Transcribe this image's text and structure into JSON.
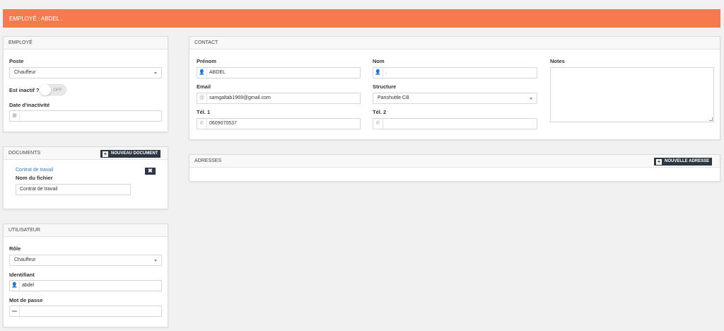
{
  "header": {
    "title": "EMPLOYÉ : ABDEL ."
  },
  "employe": {
    "title": "EMPLOYÉ",
    "poste_label": "Poste",
    "poste_value": "Chauffeur",
    "inactif_label": "Est inactif ?",
    "inactif_toggle": "OFF",
    "date_label": "Date d'inactivité",
    "date_value": ""
  },
  "documents": {
    "title": "DOCUMENTS",
    "new_button": "NOUVEAU DOCUMENT",
    "doc_link": "Contrat de travail",
    "filename_label": "Nom du fichier",
    "filename_value": "Contrat de travail"
  },
  "utilisateur": {
    "title": "UTILISATEUR",
    "role_label": "Rôle",
    "role_value": "Chauffeur",
    "ident_label": "Identifiant",
    "ident_value": "abdel",
    "pwd_label": "Mot de passe",
    "pwd_value": ""
  },
  "contact": {
    "title": "CONTACT",
    "prenom_label": "Prénom",
    "prenom_value": "ABDEL",
    "nom_label": "Nom",
    "nom_value": ".",
    "notes_label": "Notes",
    "email_label": "Email",
    "email_value": "samgaltab1969@gmail.com",
    "structure_label": "Structure",
    "structure_value": "Parishuttle CB",
    "tel1_label": "Tél. 1",
    "tel1_value": "0609070537",
    "tel2_label": "Tél. 2",
    "tel2_value": ""
  },
  "adresses": {
    "title": "ADRESSES",
    "new_button": "NOUVELLE ADRESSE"
  }
}
